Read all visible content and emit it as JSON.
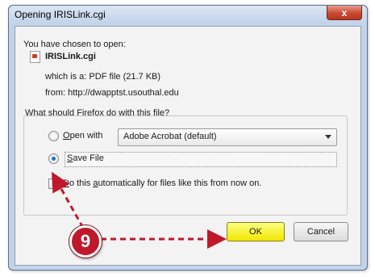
{
  "window": {
    "title": "Opening IRISLink.cgi",
    "close_label": "x"
  },
  "dialog": {
    "intro": "You have chosen to open:",
    "file_name": "IRISLink.cgi",
    "which_is": "which is a:  PDF file (21.7 KB)",
    "from": "from:  http://dwapptst.usouthal.edu",
    "question": "What should Firefox do with this file?"
  },
  "options": {
    "open_with_prefix": "",
    "open_with_underline": "O",
    "open_with_rest": "pen with",
    "open_with_app": "Adobe Acrobat  (default)",
    "save_file_underline": "S",
    "save_file_rest": "ave File",
    "auto_underline": "D",
    "auto_part1": "o this ",
    "auto_underline2": "a",
    "auto_part2": "utomatically for files like this from now on.",
    "selected": "save_file",
    "auto_checked": false
  },
  "buttons": {
    "ok": "OK",
    "cancel": "Cancel"
  },
  "annotation": {
    "step_number": "9",
    "color": "#c0182b"
  },
  "colors": {
    "ok_highlight": "#f3e600",
    "title_bar": "#c2d3ea",
    "close_button": "#c94a33"
  }
}
